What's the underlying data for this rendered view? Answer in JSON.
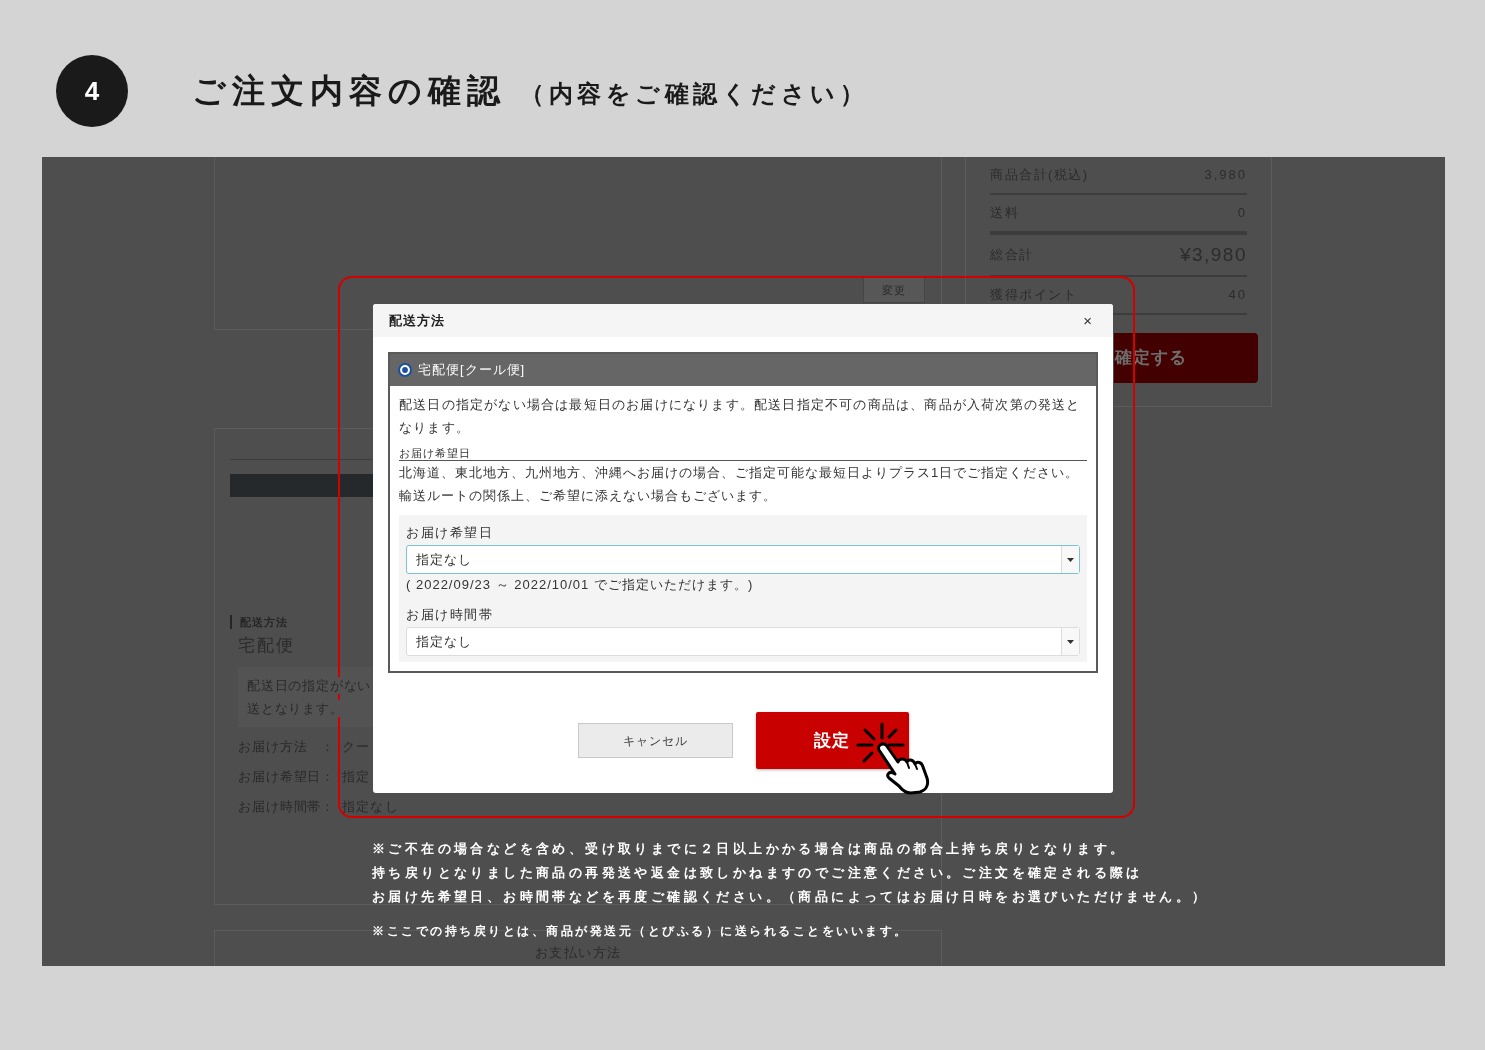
{
  "step": {
    "number": "4",
    "title": "ご注文内容の確認",
    "subtitle": "（内容をご確認ください）"
  },
  "page": {
    "top_card": {
      "change_button": "変更"
    },
    "shipping_card": {
      "heading": "配送方法",
      "method": "宅配便",
      "note_lines": [
        "配送日の指定がない",
        "送となります。"
      ],
      "details": [
        {
          "label": "お届け方法　：",
          "value": "クー"
        },
        {
          "label": "お届け希望日：",
          "value": "指定"
        },
        {
          "label": "お届け時間帯：",
          "value": "指定なし"
        }
      ]
    },
    "payment_card": {
      "heading": "お支払い方法"
    },
    "summary": {
      "rows": [
        {
          "label": "商品合計(税込)",
          "value": "3,980",
          "kind": "amount"
        },
        {
          "label": "送料",
          "value": "0",
          "kind": "amount"
        },
        {
          "label": "総合計",
          "value": "¥3,980",
          "kind": "total"
        },
        {
          "label": "獲得ポイント",
          "value": "40",
          "kind": "amount"
        }
      ],
      "confirm_button": "確定する"
    }
  },
  "dialog": {
    "title": "配送方法",
    "close": "×",
    "option": {
      "label": "宅配便[クール便]",
      "selected": true
    },
    "description": "配送日の指定がない場合は最短日のお届けになります。配送日指定不可の商品は、商品が入荷次第の発送となります。",
    "date_caption": "お届け希望日",
    "notice_lines": [
      "北海道、東北地方、九州地方、沖縄へお届けの場合、ご指定可能な最短日よりプラス1日でご指定ください。",
      "輸送ルートの関係上、ご希望に添えない場合もございます。"
    ],
    "fields": [
      {
        "label": "お届け希望日",
        "value": "指定なし",
        "focused": true,
        "range_note": "( 2022/09/23 ～ 2022/10/01 でご指定いただけます。)"
      },
      {
        "label": "お届け時間帯",
        "value": "指定なし",
        "focused": false
      }
    ],
    "buttons": [
      {
        "label": "キャンセル",
        "kind": "secondary"
      },
      {
        "label": "設定",
        "kind": "primary"
      }
    ]
  },
  "footnotes": {
    "warning_lines": [
      "※ご不在の場合などを含め、受け取りまでに２日以上かかる場合は商品の都合上持ち戻りとなります。",
      "持ち戻りとなりました商品の再発送や返金は致しかねますのでご注意ください。ご注文を確定される際は",
      "お届け先希望日、お時間帯などを再度ご確認ください。（商品によってはお届け日時をお選びいただけません。）"
    ],
    "definition": "※ここでの持ち戻りとは、商品が発送元（とびふる）に送られることをいいます。"
  }
}
